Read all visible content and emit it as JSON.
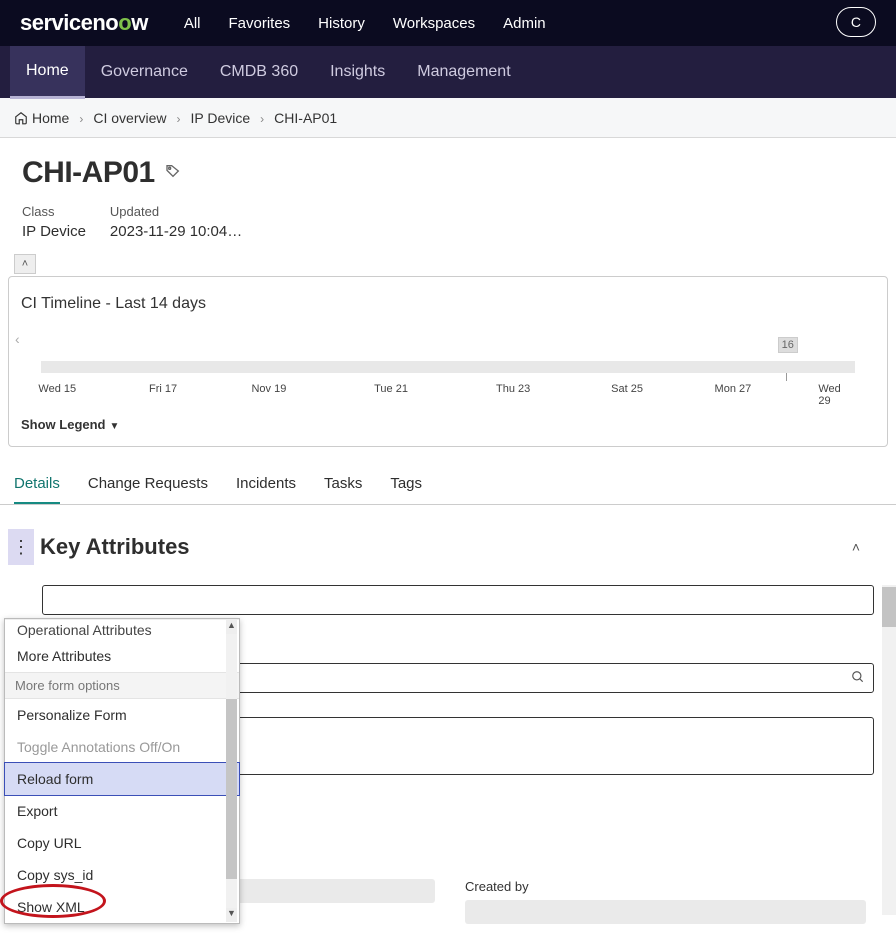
{
  "top": {
    "logo_prefix": "serviceno",
    "nav": [
      "All",
      "Favorites",
      "History",
      "Workspaces",
      "Admin"
    ],
    "right_btn": "C"
  },
  "sub_tabs": [
    "Home",
    "Governance",
    "CMDB 360",
    "Insights",
    "Management"
  ],
  "crumbs": [
    "Home",
    "CI overview",
    "IP Device",
    "CHI-AP01"
  ],
  "header": {
    "title": "CHI-AP01",
    "class_label": "Class",
    "class_value": "IP Device",
    "updated_label": "Updated",
    "updated_value": "2023-11-29 10:04…"
  },
  "timeline": {
    "title": "CI Timeline - Last 14 days",
    "mark": "16",
    "dates": [
      "Wed 15",
      "Fri 17",
      "Nov 19",
      "Tue 21",
      "Thu 23",
      "Sat 25",
      "Mon 27",
      "Wed 29"
    ],
    "legend": "Show Legend"
  },
  "detail_tabs": [
    "Details",
    "Change Requests",
    "Incidents",
    "Tasks",
    "Tags"
  ],
  "section": {
    "title": "Key Attributes"
  },
  "bottom": {
    "created_by": "Created by"
  },
  "menu": {
    "cut_top": "Operational Attributes",
    "items_top": [
      "More Attributes"
    ],
    "group": "More form options",
    "items": [
      {
        "label": "Personalize Form"
      },
      {
        "label": "Toggle Annotations Off/On",
        "faded": true
      },
      {
        "label": "Reload form",
        "selected": true
      },
      {
        "label": "Export"
      },
      {
        "label": "Copy URL"
      },
      {
        "label": "Copy sys_id"
      },
      {
        "label": "Show XML"
      }
    ]
  }
}
